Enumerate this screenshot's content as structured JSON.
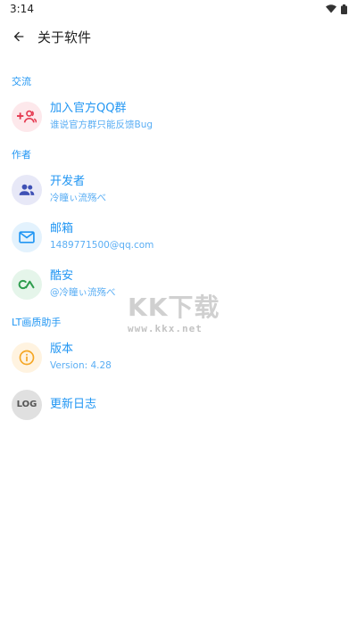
{
  "status_bar": {
    "time": "3:14",
    "wifi_icon": "wifi-icon",
    "battery_icon": "battery-icon"
  },
  "app_bar": {
    "title": "关于软件",
    "back_icon": "arrow-back-icon"
  },
  "sections": {
    "exchange": {
      "header": "交流",
      "items": [
        {
          "title": "加入官方QQ群",
          "subtitle": "谁说官方群只能反馈Bug",
          "icon": "group-add-icon",
          "icon_bg": "#fde8eb",
          "icon_color": "#e53950"
        }
      ]
    },
    "author": {
      "header": "作者",
      "items": [
        {
          "title": "开发者",
          "subtitle": "冷瞳ぃ流殇べ",
          "icon": "people-icon",
          "icon_bg": "#e7e8f7",
          "icon_color": "#3f51b5"
        },
        {
          "title": "邮箱",
          "subtitle": "1489771500@qq.com",
          "icon": "mail-icon",
          "icon_bg": "#e3f2fd",
          "icon_color": "#2196f3"
        },
        {
          "title": "酷安",
          "subtitle": "@冷瞳ぃ流殇べ",
          "icon": "coolapk-icon",
          "icon_bg": "#e5f5ea",
          "icon_color": "#2e9d4e"
        }
      ]
    },
    "lt": {
      "header": "LT画质助手",
      "items": [
        {
          "title": "版本",
          "subtitle": "Version: 4.28",
          "icon": "info-icon",
          "icon_bg": "#fff3e0",
          "icon_color": "#f5a623"
        },
        {
          "title": "更新日志",
          "icon": "log-icon",
          "icon_text": "LOG",
          "icon_bg": "#e0e0e0",
          "icon_color": "#555555"
        }
      ]
    }
  },
  "watermark": {
    "main": "KK下载",
    "url": "www.kkx.net"
  },
  "colors": {
    "accent": "#2196f3",
    "subtitle": "#5aaef4"
  }
}
